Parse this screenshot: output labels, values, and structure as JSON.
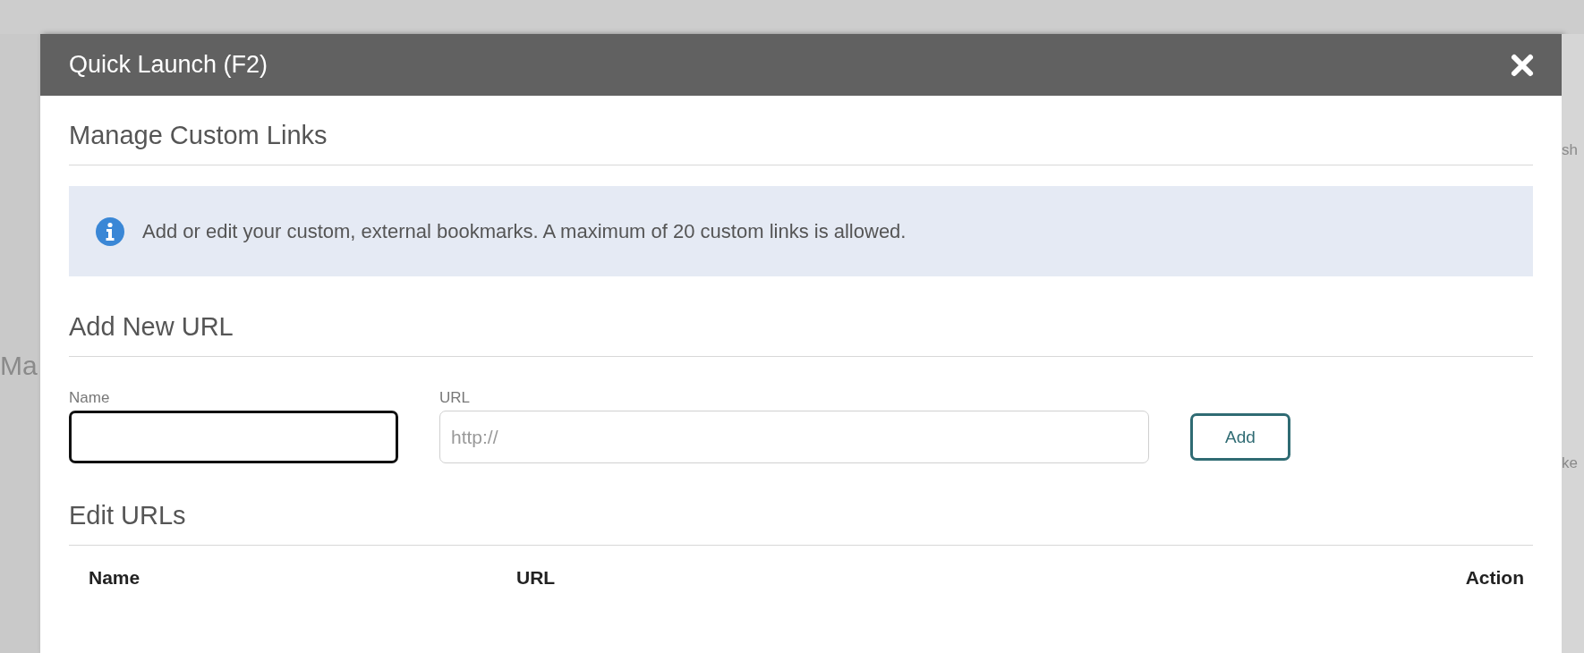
{
  "background": {
    "left_fragment": "Ma",
    "right_fragments": [
      "sh",
      "ke"
    ]
  },
  "dialog": {
    "title": "Quick Launch (F2)"
  },
  "manage_heading": "Manage Custom Links",
  "info_message": "Add or edit your custom, external bookmarks. A maximum of 20 custom links is allowed.",
  "add_heading": "Add New URL",
  "name_field": {
    "label": "Name",
    "focused": true
  },
  "url_field": {
    "label": "URL",
    "placeholder": "http://",
    "focused": false
  },
  "add_button": "Add",
  "edit_heading": "Edit URLs",
  "table": {
    "columns": [
      "Name",
      "URL",
      "Action"
    ]
  }
}
